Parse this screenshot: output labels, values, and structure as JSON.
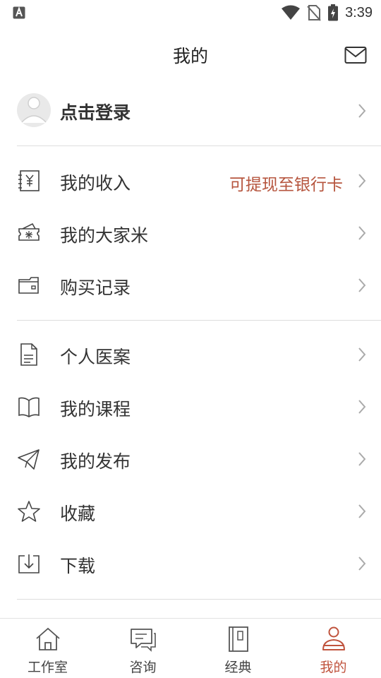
{
  "status_bar": {
    "time": "3:39"
  },
  "header": {
    "title": "我的"
  },
  "login": {
    "label": "点击登录"
  },
  "sections": [
    {
      "items": [
        {
          "label": "我的收入",
          "extra": "可提现至银行卡",
          "icon": "income-yuan-icon"
        },
        {
          "label": "我的大家米",
          "extra": "",
          "icon": "rice-ticket-icon"
        },
        {
          "label": "购买记录",
          "extra": "",
          "icon": "wallet-icon"
        }
      ]
    },
    {
      "items": [
        {
          "label": "个人医案",
          "icon": "document-icon"
        },
        {
          "label": "我的课程",
          "icon": "open-book-icon"
        },
        {
          "label": "我的发布",
          "icon": "paper-plane-icon"
        },
        {
          "label": "收藏",
          "icon": "star-icon"
        },
        {
          "label": "下载",
          "icon": "download-icon"
        }
      ]
    }
  ],
  "tabbar": {
    "active": "我的",
    "tabs": [
      {
        "label": "工作室",
        "icon": "home-icon"
      },
      {
        "label": "咨询",
        "icon": "chat-icon"
      },
      {
        "label": "经典",
        "icon": "book-icon"
      },
      {
        "label": "我的",
        "icon": "person-icon"
      }
    ]
  },
  "colors": {
    "accent": "#c0533d",
    "income_hint": "#b6553e",
    "text": "#333333",
    "divider": "#dddddd"
  }
}
